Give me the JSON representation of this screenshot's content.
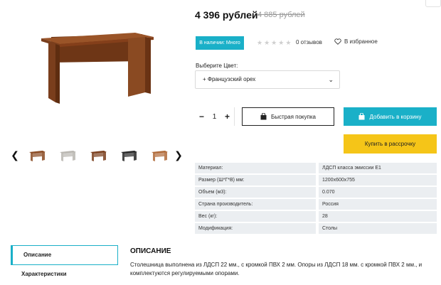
{
  "product": {
    "price": "4 396 рублей",
    "old_price": "4 885 рублей",
    "stock_badge": "В наличии: Много",
    "rating": 0,
    "reviews": "0 отзывов",
    "favorites": "В избранное"
  },
  "gallery": {
    "main_image_icon": "desk-walnut-icon",
    "thumbnails": [
      {
        "name": "desk-walnut-thumb",
        "color": "#8a4a22"
      },
      {
        "name": "desk-light-grey-thumb",
        "color": "#b9b6b0"
      },
      {
        "name": "desk-walnut-dark-thumb",
        "color": "#7a3e1c"
      },
      {
        "name": "desk-black-thumb",
        "color": "#262626"
      },
      {
        "name": "desk-light-walnut-thumb",
        "color": "#b06a38"
      }
    ]
  },
  "color_select": {
    "label": "Выберите Цвет:",
    "value": "+ Французский орех"
  },
  "quantity": {
    "minus": "−",
    "value": "1",
    "plus": "+"
  },
  "buttons": {
    "quick_buy": "Быстрая покупка",
    "add_to_cart": "Добавить в корзину",
    "installment": "Купить в рассрочку"
  },
  "specs": [
    {
      "key": "Материал:",
      "value": "ЛДСП класса эмиссии Е1"
    },
    {
      "key": "Размер (Ш*Г*В) мм:",
      "value": "1200х600х755"
    },
    {
      "key": "Объем (м3):",
      "value": "0.070"
    },
    {
      "key": "Страна производитель:",
      "value": "Россия"
    },
    {
      "key": "Вес (кг):",
      "value": "28"
    },
    {
      "key": "Модификация:",
      "value": "Столы"
    }
  ],
  "tabs": {
    "description": "Описание",
    "characteristics": "Характеристики"
  },
  "description": {
    "title": "ОПИСАНИЕ",
    "text": "Столешница выполнена из ЛДСП  22 мм., с кромкой ПВХ 2 мм. Опоры из ЛДСП 18 мм. с кромкой ПВХ 2 мм., и комплектуются регулируемыми опорами."
  },
  "colors": {
    "accent": "#1ab0c8",
    "installment": "#f5c518",
    "wood": "#8a4a22",
    "spec_bg": "#ebeef1"
  }
}
